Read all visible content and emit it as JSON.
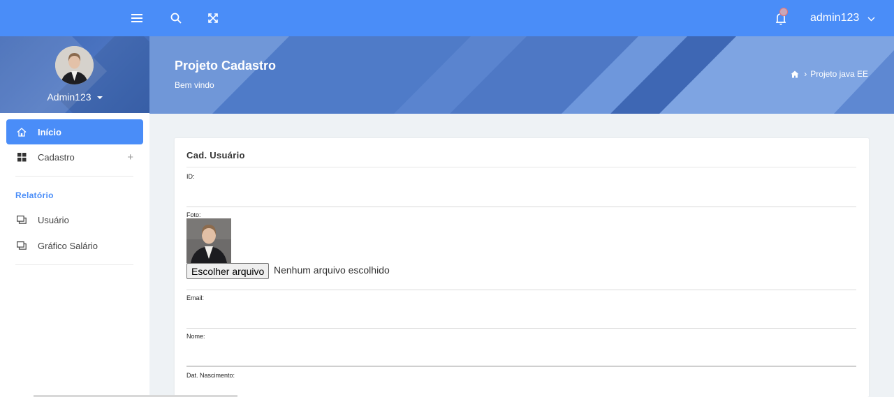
{
  "topbar": {
    "icons": [
      "menu-icon",
      "search-icon",
      "fullscreen-icon",
      "bell-icon"
    ],
    "username": "admin123"
  },
  "sidebar": {
    "username": "Admin123",
    "items": [
      {
        "label": "Início",
        "icon": "home-icon",
        "active": true
      },
      {
        "label": "Cadastro",
        "icon": "grid-icon",
        "expand": "+"
      }
    ],
    "section_title": "Relatório",
    "report_items": [
      {
        "label": "Usuário",
        "icon": "window-icon"
      },
      {
        "label": "Gráfico Salário",
        "icon": "window-icon"
      }
    ]
  },
  "header": {
    "title": "Projeto Cadastro",
    "subtitle": "Bem vindo",
    "breadcrumb": {
      "separator": "›",
      "current": "Projeto java EE"
    }
  },
  "form": {
    "title": "Cad. Usuário",
    "fields": {
      "id": {
        "label": "ID:",
        "value": ""
      },
      "foto": {
        "label": "Foto:",
        "button": "Escolher arquivo",
        "status": "Nenhum arquivo escolhido"
      },
      "email": {
        "label": "Email:",
        "value": ""
      },
      "nome": {
        "label": "Nome:",
        "value": ""
      },
      "nascimento": {
        "label": "Dat. Nascimento:",
        "value": ""
      }
    }
  },
  "colors": {
    "accent": "#4a8df8",
    "header_dark": "#3a64b3",
    "page_bg": "#eef2f5"
  }
}
